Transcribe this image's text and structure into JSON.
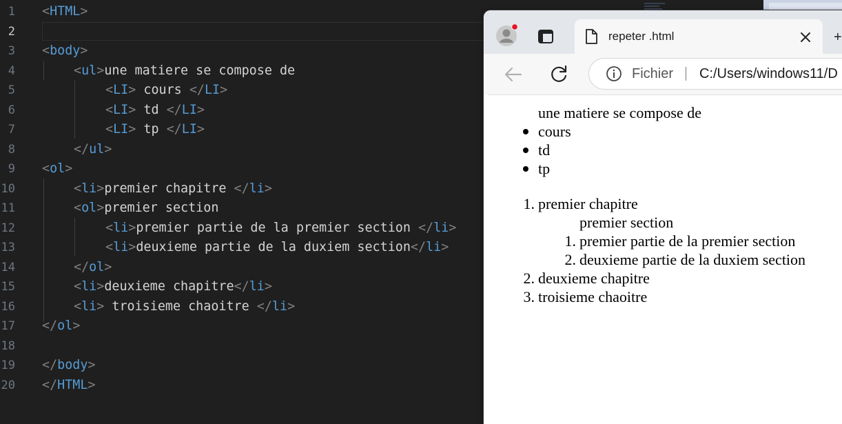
{
  "editor": {
    "active_line": 2,
    "lines": [
      {
        "n": "1",
        "indent": 0,
        "tokens": [
          [
            "p",
            "<"
          ],
          [
            "t",
            "HTML"
          ],
          [
            "p",
            ">"
          ]
        ]
      },
      {
        "n": "2",
        "indent": 0,
        "tokens": []
      },
      {
        "n": "3",
        "indent": 0,
        "tokens": [
          [
            "p",
            "<"
          ],
          [
            "t",
            "body"
          ],
          [
            "p",
            ">"
          ]
        ]
      },
      {
        "n": "4",
        "indent": 1,
        "tokens": [
          [
            "p",
            "<"
          ],
          [
            "t",
            "ul"
          ],
          [
            "p",
            ">"
          ],
          [
            "x",
            "une matiere se compose de"
          ]
        ]
      },
      {
        "n": "5",
        "indent": 2,
        "tokens": [
          [
            "p",
            "<"
          ],
          [
            "t",
            "LI"
          ],
          [
            "p",
            "> "
          ],
          [
            "x",
            "cours "
          ],
          [
            "p",
            "</"
          ],
          [
            "t",
            "LI"
          ],
          [
            "p",
            ">"
          ]
        ]
      },
      {
        "n": "6",
        "indent": 2,
        "tokens": [
          [
            "p",
            "<"
          ],
          [
            "t",
            "LI"
          ],
          [
            "p",
            "> "
          ],
          [
            "x",
            "td "
          ],
          [
            "p",
            "</"
          ],
          [
            "t",
            "LI"
          ],
          [
            "p",
            ">"
          ]
        ]
      },
      {
        "n": "7",
        "indent": 2,
        "tokens": [
          [
            "p",
            "<"
          ],
          [
            "t",
            "LI"
          ],
          [
            "p",
            "> "
          ],
          [
            "x",
            "tp "
          ],
          [
            "p",
            "</"
          ],
          [
            "t",
            "LI"
          ],
          [
            "p",
            ">"
          ]
        ]
      },
      {
        "n": "8",
        "indent": 1,
        "tokens": [
          [
            "p",
            "</"
          ],
          [
            "t",
            "ul"
          ],
          [
            "p",
            ">"
          ]
        ]
      },
      {
        "n": "9",
        "indent": 0,
        "tokens": [
          [
            "p",
            "<"
          ],
          [
            "t",
            "ol"
          ],
          [
            "p",
            ">"
          ]
        ]
      },
      {
        "n": "10",
        "indent": 1,
        "tokens": [
          [
            "p",
            "<"
          ],
          [
            "t",
            "li"
          ],
          [
            "p",
            ">"
          ],
          [
            "x",
            "premier chapitre "
          ],
          [
            "p",
            "</"
          ],
          [
            "t",
            "li"
          ],
          [
            "p",
            ">"
          ]
        ]
      },
      {
        "n": "11",
        "indent": 1,
        "tokens": [
          [
            "p",
            "<"
          ],
          [
            "t",
            "ol"
          ],
          [
            "p",
            ">"
          ],
          [
            "x",
            "premier section"
          ]
        ]
      },
      {
        "n": "12",
        "indent": 2,
        "tokens": [
          [
            "p",
            "<"
          ],
          [
            "t",
            "li"
          ],
          [
            "p",
            ">"
          ],
          [
            "x",
            "premier partie de la premier section "
          ],
          [
            "p",
            "</"
          ],
          [
            "t",
            "li"
          ],
          [
            "p",
            ">"
          ]
        ]
      },
      {
        "n": "13",
        "indent": 2,
        "tokens": [
          [
            "p",
            "<"
          ],
          [
            "t",
            "li"
          ],
          [
            "p",
            ">"
          ],
          [
            "x",
            "deuxieme partie de la duxiem section"
          ],
          [
            "p",
            "</"
          ],
          [
            "t",
            "li"
          ],
          [
            "p",
            ">"
          ]
        ]
      },
      {
        "n": "14",
        "indent": 1,
        "tokens": [
          [
            "p",
            "</"
          ],
          [
            "t",
            "ol"
          ],
          [
            "p",
            ">"
          ]
        ]
      },
      {
        "n": "15",
        "indent": 1,
        "tokens": [
          [
            "p",
            "<"
          ],
          [
            "t",
            "li"
          ],
          [
            "p",
            ">"
          ],
          [
            "x",
            "deuxieme chapitre"
          ],
          [
            "p",
            "</"
          ],
          [
            "t",
            "li"
          ],
          [
            "p",
            ">"
          ]
        ]
      },
      {
        "n": "16",
        "indent": 1,
        "tokens": [
          [
            "p",
            "<"
          ],
          [
            "t",
            "li"
          ],
          [
            "p",
            "> "
          ],
          [
            "x",
            "troisieme chaoitre "
          ],
          [
            "p",
            "</"
          ],
          [
            "t",
            "li"
          ],
          [
            "p",
            ">"
          ]
        ]
      },
      {
        "n": "17",
        "indent": 0,
        "tokens": [
          [
            "p",
            "</"
          ],
          [
            "t",
            "ol"
          ],
          [
            "p",
            ">"
          ]
        ]
      },
      {
        "n": "18",
        "indent": 0,
        "tokens": []
      },
      {
        "n": "19",
        "indent": 0,
        "tokens": [
          [
            "p",
            "</"
          ],
          [
            "t",
            "body"
          ],
          [
            "p",
            ">"
          ]
        ]
      },
      {
        "n": "20",
        "indent": 0,
        "tokens": [
          [
            "p",
            "</"
          ],
          [
            "t",
            "HTML"
          ],
          [
            "p",
            ">"
          ]
        ]
      }
    ]
  },
  "browser": {
    "tab_title": "repeter .html",
    "site_label": "Fichier",
    "url": "C:/Users/windows11/D",
    "newtab_glyph": "+",
    "icons": {
      "profile": "profile-avatar-icon",
      "tabs": "vertical-tabs-icon",
      "page": "page-document-icon",
      "close": "close-icon",
      "back": "back-arrow-icon",
      "reload": "reload-icon",
      "info": "info-icon"
    },
    "page": {
      "ul_heading": "une matiere se compose de",
      "ul_items": [
        "cours",
        "td",
        "tp"
      ],
      "ol_items": [
        {
          "num": "1.",
          "text": "premier chapitre"
        },
        {
          "num": "2.",
          "text": "deuxieme chapitre"
        },
        {
          "num": "3.",
          "text": "troisieme chaoitre"
        }
      ],
      "nested_heading": "premier section",
      "nested_items": [
        {
          "num": "1.",
          "text": "premier partie de la premier section"
        },
        {
          "num": "2.",
          "text": "deuxieme partie de la duxiem section"
        }
      ]
    }
  },
  "colors": {
    "editor_bg": "#1f1f1f",
    "tag": "#569cd6",
    "punct": "#808080",
    "text": "#d4d4d4",
    "notification_dot": "#e81123"
  }
}
